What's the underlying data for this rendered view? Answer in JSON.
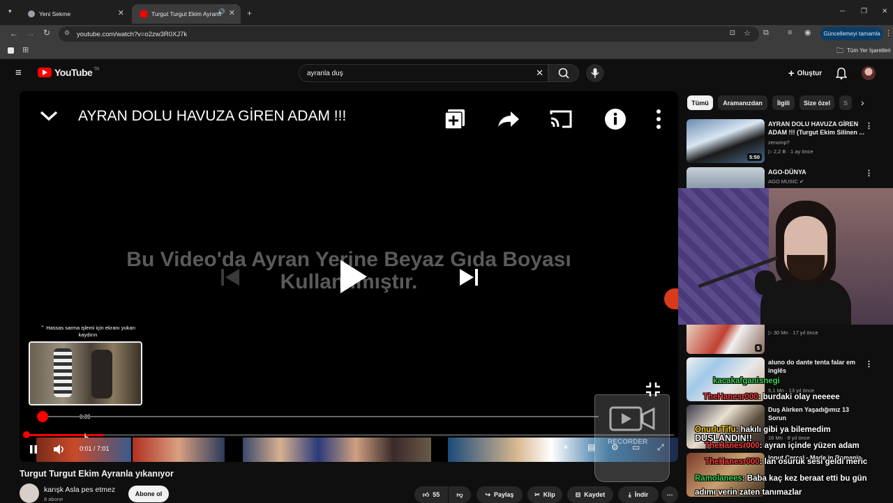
{
  "browser": {
    "tabs": [
      {
        "title": "Yeni Sekme"
      },
      {
        "title": "Turgut Turgut Ekim Ayranla"
      }
    ],
    "url": "youtube.com/watch?v=o2zw3R0XJ7k",
    "update_button": "Güncellemeyi tamamla",
    "bookmarks_all": "Tüm Yer İşaretleri"
  },
  "header": {
    "logo_text": "YouTube",
    "region": "TR",
    "search_value": "ayranla duş",
    "create_label": "Oluştur"
  },
  "player": {
    "title": "AYRAN DOLU HAVUZA GİREN ADAM !!!",
    "overlay_line1": "Bu Video'da Ayran Yerine Beyaz Gıda Boyası",
    "overlay_line2": "Kullanılmıştır.",
    "seek_hint": "Hassas sarma işlemi için ekranı yukarı kaydırın",
    "preview_time": "0:39",
    "time_display": "0:01 / 7:01",
    "progress_fraction": 0.012,
    "recorder_watermark": "RECORDER"
  },
  "video": {
    "title": "Turgut Turgut Ekim Ayranla yıkanıyor",
    "channel": "karışk Asla pes etmez",
    "subscribers": "8 abone",
    "subscribe_label": "Abone ol",
    "likes": "55",
    "share_label": "Paylaş",
    "clip_label": "Klip",
    "save_label": "Kaydet",
    "download_label": "İndir"
  },
  "chips": [
    "Tümü",
    "Aramanızdan",
    "İlgili",
    "Size özel",
    "S"
  ],
  "recommendations": [
    {
      "title": "AYRAN DOLU HAVUZA GİREN ADAM !!! (Turgut Ekim Silinen ...",
      "channel": "zenomp?",
      "meta": "2,2 B  ·  1 ay önce",
      "duration": "5:50"
    },
    {
      "title": "AGO-DÜNYA",
      "channel": "AGO MUSIC",
      "meta": "",
      "duration": ""
    },
    {
      "title": "",
      "channel": "",
      "meta": "30 Mn  ·  17 yıl önce",
      "duration": "5"
    },
    {
      "title": "aluno do dante tenta falar em inglês",
      "channel": "",
      "meta": "5,1 Mn  ·  13 yıl önce",
      "duration": ""
    },
    {
      "title": "Duş Alırken Yaşadığımız 13 Sorun",
      "channel": "",
      "meta": "16 Mn  ·  8 yıl önce",
      "duration": ""
    },
    {
      "title": "Ionut Cercel - Made in Romania",
      "channel": "",
      "meta": "",
      "duration": ""
    }
  ],
  "chat": [
    {
      "user": "kacakafganisnegi",
      "message": "",
      "user_color": "#39d353"
    },
    {
      "user": "TheHanesr000",
      "message": ": burdaki olay neeeee",
      "user_color": "#ff3b3b"
    },
    {
      "user": "OnurluTifu",
      "message": ": hakılı gibi ya bilemedim",
      "user_color": "#ffd21f"
    },
    {
      "user": "",
      "message": "DUŞLANDIN!!",
      "user_color": "#ffffff"
    },
    {
      "user": "TheHanesr000",
      "message": ": ayran içinde yüzen adam",
      "user_color": "#ff3b3b"
    },
    {
      "user": "TheHanesr000",
      "message": ": lan osuruk sesi geldi meric",
      "user_color": "#ff3b3b"
    },
    {
      "user": "Ramolanees",
      "message": ": Baba kaç kez beraat etti bu gün",
      "user_color": "#39d353"
    },
    {
      "user": "",
      "message": "adımı verin zaten tanımazlar",
      "user_color": "#ffffff"
    }
  ],
  "colors": {
    "accent": "#ff0000",
    "background": "#0f0f0f",
    "chip": "#272727"
  }
}
